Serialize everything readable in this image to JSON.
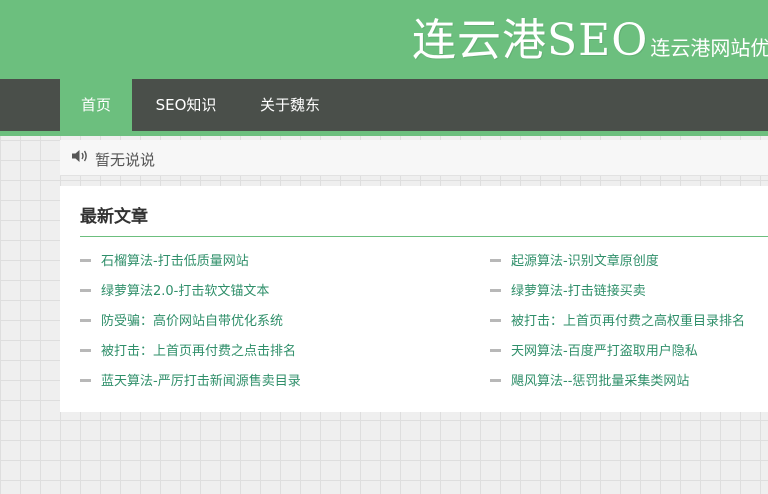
{
  "header": {
    "logo_main": "连云港SEO",
    "logo_sub": "连云港网站优"
  },
  "nav": {
    "items": [
      {
        "label": "首页",
        "active": true
      },
      {
        "label": "SEO知识",
        "active": false
      },
      {
        "label": "关于魏东",
        "active": false
      }
    ]
  },
  "notice": {
    "icon": "speaker-icon",
    "text": "暂无说说"
  },
  "latest": {
    "title": "最新文章",
    "left": [
      "石榴算法-打击低质量网站",
      "绿萝算法2.0-打击软文锚文本",
      "防受骗：高价网站自带优化系统",
      "被打击：上首页再付费之点击排名",
      "蓝天算法-严厉打击新闻源售卖目录"
    ],
    "right": [
      "起源算法-识别文章原创度",
      "绿萝算法-打击链接买卖",
      "被打击：上首页再付费之高权重目录排名",
      "天网算法-百度严打盗取用户隐私",
      "飓风算法--惩罚批量采集类网站"
    ]
  },
  "colors": {
    "brand_green": "#6cbf7e",
    "nav_dark": "#4a4f4a",
    "link_green": "#2f8f6a"
  }
}
